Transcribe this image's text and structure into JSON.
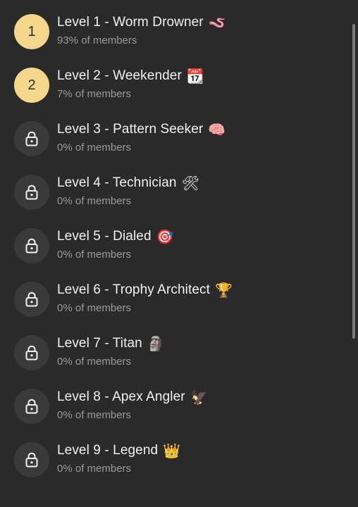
{
  "levels": [
    {
      "badge": "1",
      "locked": false,
      "title": "Level 1 - Worm Drowner",
      "emoji": "🪱",
      "emoji_name": "worm-icon",
      "members": "93% of members"
    },
    {
      "badge": "2",
      "locked": false,
      "title": "Level 2 - Weekender",
      "emoji": "📆",
      "emoji_name": "calendar-icon",
      "members": "7% of members"
    },
    {
      "badge": "",
      "locked": true,
      "title": "Level 3 - Pattern Seeker",
      "emoji": "🧠",
      "emoji_name": "brain-icon",
      "members": "0% of members"
    },
    {
      "badge": "",
      "locked": true,
      "title": "Level 4 - Technician",
      "emoji": "🛠",
      "emoji_name": "tools-icon",
      "members": "0% of members"
    },
    {
      "badge": "",
      "locked": true,
      "title": "Level 5 - Dialed",
      "emoji": "🎯",
      "emoji_name": "target-icon",
      "members": "0% of members"
    },
    {
      "badge": "",
      "locked": true,
      "title": "Level 6 - Trophy Architect",
      "emoji": "🏆",
      "emoji_name": "trophy-icon",
      "members": "0% of members"
    },
    {
      "badge": "",
      "locked": true,
      "title": "Level 7 - Titan",
      "emoji": "🗿",
      "emoji_name": "moai-icon",
      "members": "0% of members"
    },
    {
      "badge": "",
      "locked": true,
      "title": "Level 8 - Apex Angler",
      "emoji": "🦅",
      "emoji_name": "eagle-icon",
      "members": "0% of members"
    },
    {
      "badge": "",
      "locked": true,
      "title": "Level 9 - Legend",
      "emoji": "👑",
      "emoji_name": "crown-icon",
      "members": "0% of members"
    }
  ],
  "colors": {
    "background": "#2a2a2a",
    "unlocked_badge": "#f4d78a",
    "locked_badge": "#3a3a3a",
    "subtitle": "#9a9a9a"
  }
}
